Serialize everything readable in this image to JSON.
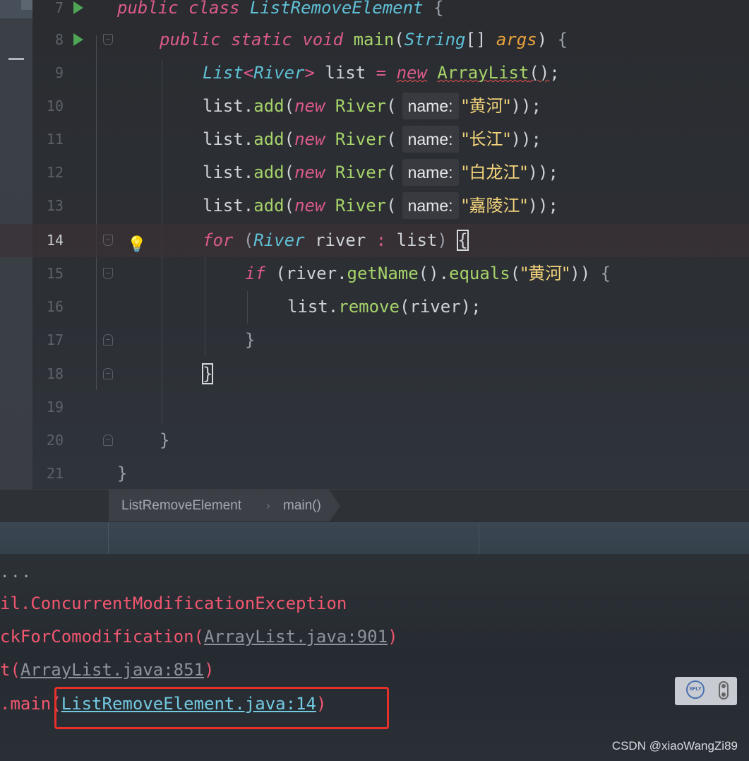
{
  "editor": {
    "line_numbers": [
      "7",
      "8",
      "9",
      "10",
      "11",
      "12",
      "13",
      "14",
      "15",
      "16",
      "17",
      "18",
      "19",
      "20",
      "21"
    ],
    "tokens": {
      "public": "public",
      "class": "class",
      "class_name": "ListRemoveElement",
      "open_brace": "{",
      "close_brace": "}",
      "static": "static",
      "void": "void",
      "main": "main",
      "String": "String",
      "args": "args",
      "List": "List",
      "River": "River",
      "list": "list",
      "new": "new",
      "ArrayList": "ArrayList",
      "add": "add",
      "for": "for",
      "river": "river",
      "if": "if",
      "getName": "getName",
      "equals": "equals",
      "remove": "remove",
      "name_hint": "name:"
    },
    "strings": {
      "huanghe": "\"黄河\"",
      "changjiang": "\"长江\"",
      "bailongjiang": "\"白龙江\"",
      "jialingjiang": "\"嘉陵江\""
    }
  },
  "breadcrumb": {
    "items": [
      "ListRemoveElement",
      "main()"
    ],
    "separator": "›"
  },
  "console": {
    "ellipsis": "...",
    "lines": {
      "exception": "il.ConcurrentModificationException",
      "check_prefix": "ckForComodification(",
      "check_link": "ArrayList.java:901",
      "next_prefix": "t(",
      "next_link": "ArrayList.java:851",
      "main_prefix": ".main(",
      "main_link": "ListRemoveElement.java:14",
      "close_paren": ")"
    }
  },
  "plugin": {
    "logo_text": "SFLY"
  },
  "watermark": "CSDN @xiaoWangZi89",
  "colors": {
    "keyword": "#dc5a8c",
    "type": "#5fc0d6",
    "function": "#a6d36a",
    "string": "#f2d37b",
    "error": "#f2576f",
    "highlight_box": "#e8302a"
  }
}
